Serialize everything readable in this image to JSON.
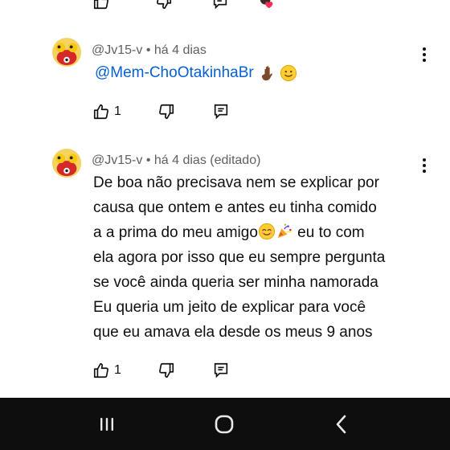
{
  "prev_comment": {
    "icons": [
      "thumb-up-icon",
      "thumb-down-icon",
      "reply-icon",
      "creator-heart-icon"
    ]
  },
  "comments": [
    {
      "author": "@Jv15-v",
      "separator": "•",
      "time": "há 4 dias",
      "mention": "@Mem-ChoOtakinhaBr",
      "emojis": [
        "waving-hand-dark-skin-emoji",
        "slightly-smiling-emoji"
      ],
      "likes": "1"
    },
    {
      "author": "@Jv15-v",
      "separator": "•",
      "time": "há 4 dias (editado)",
      "lines": [
        "De boa não precisava nem se explicar por",
        "causa que ontem e antes  eu tinha comido",
        "a a prima do meu amigo",
        " eu to com",
        "ela agora por isso que eu sempre pergunta",
        "se você ainda queria ser minha namorada",
        "Eu queria  um  jeito de explicar para você",
        "que eu amava ela desde os meus 9 anos"
      ],
      "inline_emojis": [
        "smiling-eyes-emoji",
        "party-popper-emoji"
      ],
      "likes": "1"
    }
  ],
  "navbar": {
    "buttons": [
      "recent-apps",
      "home",
      "back"
    ]
  },
  "colors": {
    "mention": "#065fd4",
    "meta": "#606060",
    "text": "#0f0f0f",
    "navbar": "#0e0e0e"
  }
}
